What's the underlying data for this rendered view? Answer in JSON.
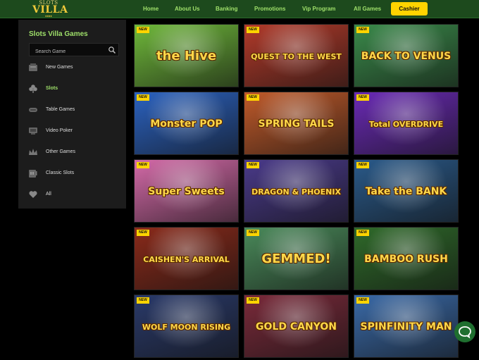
{
  "logo": {
    "top": "SLOTS",
    "main": "VILLA",
    "dots": "●●●●"
  },
  "nav": {
    "items": [
      "Home",
      "About Us",
      "Banking",
      "Promotions",
      "Vip Program",
      "All Games"
    ],
    "cashier": "Cashier"
  },
  "sidebar": {
    "title": "Slots Villa Games",
    "search_placeholder": "Search Game",
    "items": [
      {
        "label": "New Games",
        "icon": "new-games-icon"
      },
      {
        "label": "Slots",
        "icon": "clover-icon",
        "active": true
      },
      {
        "label": "Table Games",
        "icon": "table-games-icon"
      },
      {
        "label": "Video Poker",
        "icon": "video-poker-icon"
      },
      {
        "label": "Other Games",
        "icon": "crown-icon"
      },
      {
        "label": "Classic Slots",
        "icon": "classic-slots-icon"
      },
      {
        "label": "All",
        "icon": "heart-icon"
      }
    ]
  },
  "games": [
    {
      "badge": "NEW",
      "title": "the Hive",
      "color": "#6fb83a"
    },
    {
      "badge": "NEW",
      "title": "QUEST TO THE WEST",
      "color": "#b23a2a"
    },
    {
      "badge": "NEW",
      "title": "BACK TO VENUS",
      "color": "#3a8a4a"
    },
    {
      "badge": "NEW",
      "title": "Monster POP",
      "color": "#2b62c0"
    },
    {
      "badge": "NEW",
      "title": "SPRING TAILS",
      "color": "#c05a2a"
    },
    {
      "badge": "NEW",
      "title": "Total OVERDRIVE",
      "color": "#6a2ab5"
    },
    {
      "badge": "NEW",
      "title": "Super Sweets",
      "color": "#d46aa8"
    },
    {
      "badge": "NEW",
      "title": "DRAGON & PHOENIX",
      "color": "#4a3a8a"
    },
    {
      "badge": "NEW",
      "title": "Take the BANK",
      "color": "#2a5a8a"
    },
    {
      "badge": "NEW",
      "title": "CAISHEN'S ARRIVAL",
      "color": "#8a2a1a"
    },
    {
      "badge": "NEW",
      "title": "GEMMED!",
      "color": "#4a8a5a"
    },
    {
      "badge": "NEW",
      "title": "BAMBOO RUSH",
      "color": "#2f6a2a"
    },
    {
      "badge": "NEW",
      "title": "WOLF MOON RISING",
      "color": "#2a3a6a"
    },
    {
      "badge": "NEW",
      "title": "GOLD CANYON",
      "color": "#7a2a3a"
    },
    {
      "badge": "NEW",
      "title": "SPINFINITY MAN",
      "color": "#3a6aa8"
    }
  ]
}
